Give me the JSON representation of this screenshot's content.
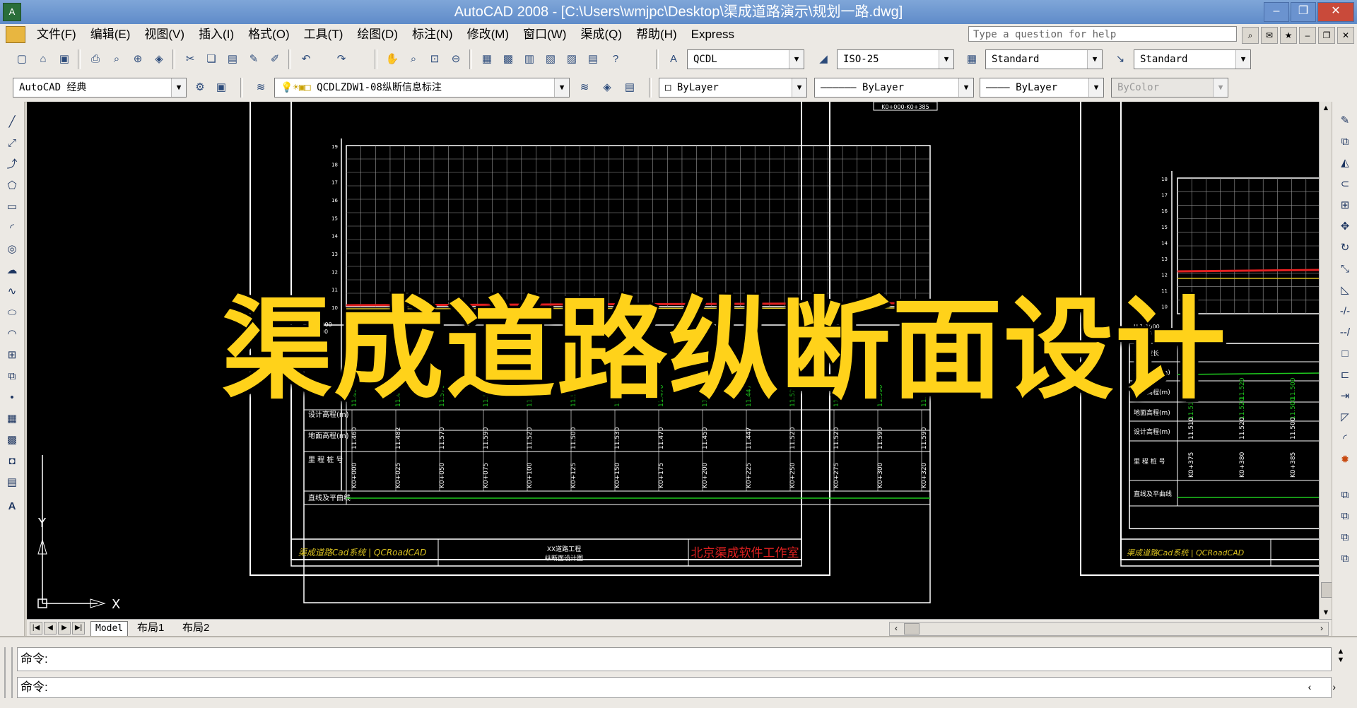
{
  "window": {
    "title": "AutoCAD 2008 - [C:\\Users\\wmjpc\\Desktop\\渠成道路演示\\规划一路.dwg]",
    "app_icon": "autocad-icon",
    "buttons": {
      "minimize": "–",
      "restore": "❐",
      "close": "✕"
    }
  },
  "menu": {
    "items": [
      "文件(F)",
      "编辑(E)",
      "视图(V)",
      "插入(I)",
      "格式(O)",
      "工具(T)",
      "绘图(D)",
      "标注(N)",
      "修改(M)",
      "窗口(W)",
      "渠成(Q)",
      "帮助(H)",
      "Express"
    ],
    "help_placeholder": "Type a question for help"
  },
  "toolbar_standard": {
    "text_style": "QCDL",
    "dim_style": "ISO-25",
    "table_style": "Standard",
    "multileader_style": "Standard"
  },
  "toolbar_layers": {
    "workspace": "AutoCAD 经典",
    "layer": "QCDLZDW1-08纵断信息标注",
    "color": "ByLayer",
    "linetype": "ByLayer",
    "lineweight": "ByLayer",
    "plotstyle": "ByColor"
  },
  "drawing": {
    "header_tag": "K0+000-K0+385",
    "y_axis_ticks_left": [
      "19",
      "18",
      "17",
      "16",
      "15",
      "14",
      "13",
      "12",
      "11",
      "10"
    ],
    "y_axis_ticks_right": [
      "18",
      "17",
      "16",
      "15",
      "14",
      "13",
      "12",
      "11",
      "10"
    ],
    "scale_left": [
      "H 1:1000",
      "V 1:100"
    ],
    "scale_right": [
      "H 1:1000",
      "V 1:100"
    ],
    "table_rows_left": [
      "设计高程(m)",
      "地面高程(m)",
      "里 程 桩 号",
      "直线及平曲线"
    ],
    "table_rows_right": [
      "坡度坡长",
      "地面标高(m)",
      "设计高程(m)",
      "地面高程(m)",
      "里 程 桩 号",
      "直线及平曲线"
    ],
    "elev_values_left": [
      "11.460",
      "11.482",
      "11.570",
      "11.590",
      "11.520",
      "11.500",
      "11.530",
      "11.470",
      "11.450",
      "11.447",
      "11.520",
      "11.520",
      "11.590",
      "11.590"
    ],
    "station_values_left": [
      "K0+000",
      "K0+025",
      "K0+050",
      "K0+075",
      "K0+100",
      "K0+125",
      "K0+150",
      "K0+175",
      "K0+200",
      "K0+225",
      "K0+250",
      "K0+275",
      "K0+300",
      "K0+320"
    ],
    "elev_values_right": [
      "11.510",
      "11.520",
      "11.500"
    ],
    "station_values_right": [
      "K0+375",
      "K0+380",
      "K0+385"
    ],
    "title_block_left": "渠成道路Cad系统 | QCRoadCAD",
    "title_block_mid": [
      "XX道路工程",
      "纵断面设计图"
    ],
    "title_block_right": "北京渠成软件工作室",
    "title_block_right2": "渠成道路Cad系统 | QCRoadCAD",
    "ucs_y": "Y",
    "ucs_x": "X"
  },
  "layout_tabs": [
    "Model",
    "布局1",
    "布局2"
  ],
  "command": {
    "line1": "命令:",
    "line2": "命令:"
  },
  "overlay": {
    "title": "渠成道路纵断面设计"
  },
  "colors": {
    "canvas": "#000000",
    "overlay_text": "#ffd21a",
    "ground_line": "#e02020",
    "design_line": "#d8c020",
    "data_green": "#1ec81e",
    "title_red": "#e02020"
  }
}
